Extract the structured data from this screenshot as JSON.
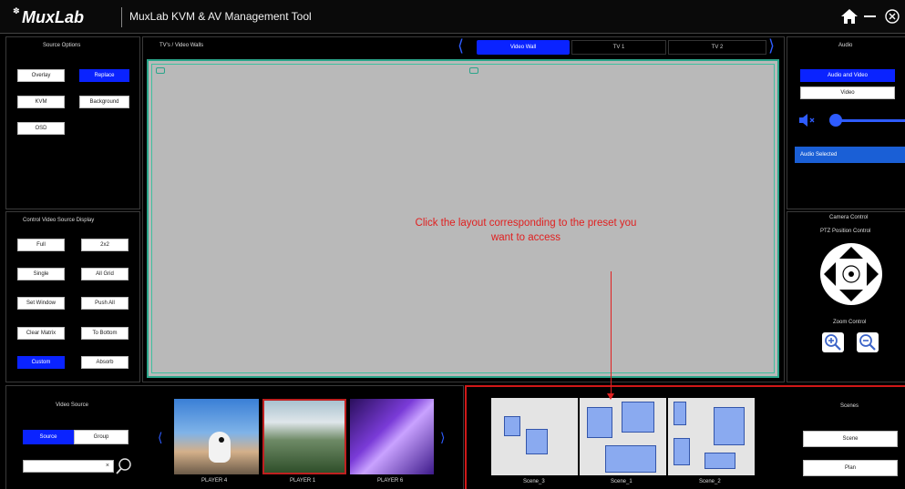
{
  "header": {
    "logo_text": "MuxLab",
    "title": "MuxLab KVM & AV Management Tool"
  },
  "source_options": {
    "title": "Source Options",
    "buttons": [
      "Overlay",
      "Replace",
      "KVM",
      "Background",
      "OSD"
    ]
  },
  "control_display": {
    "title": "Control Video Source Display",
    "buttons": [
      "Full",
      "2x2",
      "Single",
      "All Grid",
      "Set Window",
      "Push All",
      "Clear Matrix",
      "To Bottom",
      "Custom",
      "Absorb"
    ]
  },
  "center": {
    "title": "TV's / Video Walls",
    "tabs": [
      "Video Wall",
      "TV 1",
      "TV 2"
    ]
  },
  "annotation": {
    "line1": "Click the layout corresponding to the preset you",
    "line2": "want to access"
  },
  "audio": {
    "title": "Audio",
    "buttons": [
      "Audio and Video",
      "Video"
    ],
    "selected_text": "Audio Selected",
    "volume_level": 0.12
  },
  "camera": {
    "title": "Camera Control",
    "ptz_label": "PTZ Position Control",
    "zoom_label": "Zoom Control"
  },
  "video_source": {
    "title": "Video Source",
    "toggle": [
      "Source",
      "Group"
    ],
    "search_value": ""
  },
  "players": [
    "PLAYER 4",
    "PLAYER 1",
    "PLAYER 6"
  ],
  "scenes_thumbs": [
    "Scene_3",
    "Scene_1",
    "Scene_2"
  ],
  "scenes": {
    "title": "Scenes",
    "buttons": [
      "Scene",
      "Plan"
    ]
  },
  "colors": {
    "accent": "#0a23ff",
    "annotation": "#e02020",
    "wall_border": "#2aa58a",
    "canvas": "#b9b9b9"
  }
}
